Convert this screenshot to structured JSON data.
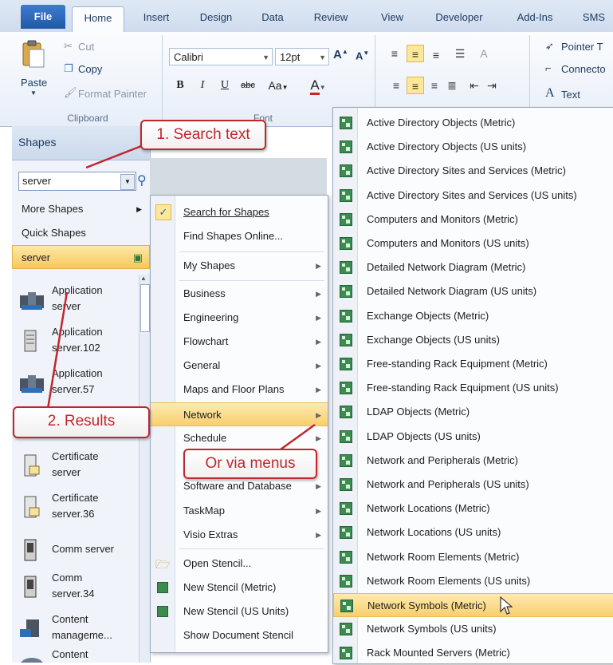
{
  "tabs": [
    "File",
    "Home",
    "Insert",
    "Design",
    "Data",
    "Review",
    "View",
    "Developer",
    "Add-Ins",
    "SMS"
  ],
  "clipboard": {
    "paste": "Paste",
    "cut": "Cut",
    "copy": "Copy",
    "format_painter": "Format Painter",
    "label": "Clipboard"
  },
  "font": {
    "family": "Calibri",
    "size": "12pt",
    "bold": "B",
    "italic": "I",
    "underline": "U",
    "strike": "abc",
    "case": "Aa",
    "color": "A",
    "label": "Font"
  },
  "tools": {
    "pointer": "Pointer T",
    "connector": "Connecto",
    "text": "Text"
  },
  "pane": {
    "title": "Shapes",
    "search_value": "server",
    "more_shapes": "More Shapes",
    "quick_shapes": "Quick Shapes",
    "active_stencil": "server",
    "shapes": [
      {
        "l1": "Application",
        "l2": "server"
      },
      {
        "l1": "Application",
        "l2": "server.102"
      },
      {
        "l1": "Application",
        "l2": "server.57"
      },
      {
        "l1": "Certificate",
        "l2": "server"
      },
      {
        "l1": "Certificate",
        "l2": "server.36"
      },
      {
        "l1": "Comm server",
        "l2": ""
      },
      {
        "l1": "Comm",
        "l2": "server.34"
      },
      {
        "l1": "Content",
        "l2": "manageme..."
      },
      {
        "l1": "Content",
        "l2": ""
      }
    ]
  },
  "menu1": {
    "search_for_shapes": "Search for Shapes",
    "find_online": "Find Shapes Online...",
    "my_shapes": "My Shapes",
    "categories": [
      "Business",
      "Engineering",
      "Flowchart",
      "General",
      "Maps and Floor Plans",
      "Network",
      "Schedule",
      "Software and Database",
      "TaskMap",
      "Visio Extras"
    ],
    "open_stencil": "Open Stencil...",
    "new_metric": "New Stencil (Metric)",
    "new_us": "New Stencil (US Units)",
    "show_doc": "Show Document Stencil"
  },
  "menu2": [
    "Active Directory Objects (Metric)",
    "Active Directory Objects (US units)",
    "Active Directory Sites and Services (Metric)",
    "Active Directory Sites and Services (US units)",
    "Computers and Monitors (Metric)",
    "Computers and Monitors (US units)",
    "Detailed Network Diagram (Metric)",
    "Detailed Network Diagram (US units)",
    "Exchange Objects (Metric)",
    "Exchange Objects (US units)",
    "Free-standing Rack Equipment (Metric)",
    "Free-standing Rack Equipment (US units)",
    "LDAP Objects (Metric)",
    "LDAP Objects (US units)",
    "Network and Peripherals (Metric)",
    "Network and Peripherals (US units)",
    "Network Locations (Metric)",
    "Network Locations (US units)",
    "Network Room Elements (Metric)",
    "Network Room Elements (US units)",
    "Network Symbols (Metric)",
    "Network Symbols (US units)",
    "Rack Mounted Servers (Metric)"
  ],
  "callouts": {
    "search": "1. Search text",
    "results": "2. Results",
    "menus": "Or via menus"
  },
  "colors": {
    "accent": "#c0272d",
    "highlight": "#f8cf6d",
    "file_tab": "#1f5aa8"
  }
}
